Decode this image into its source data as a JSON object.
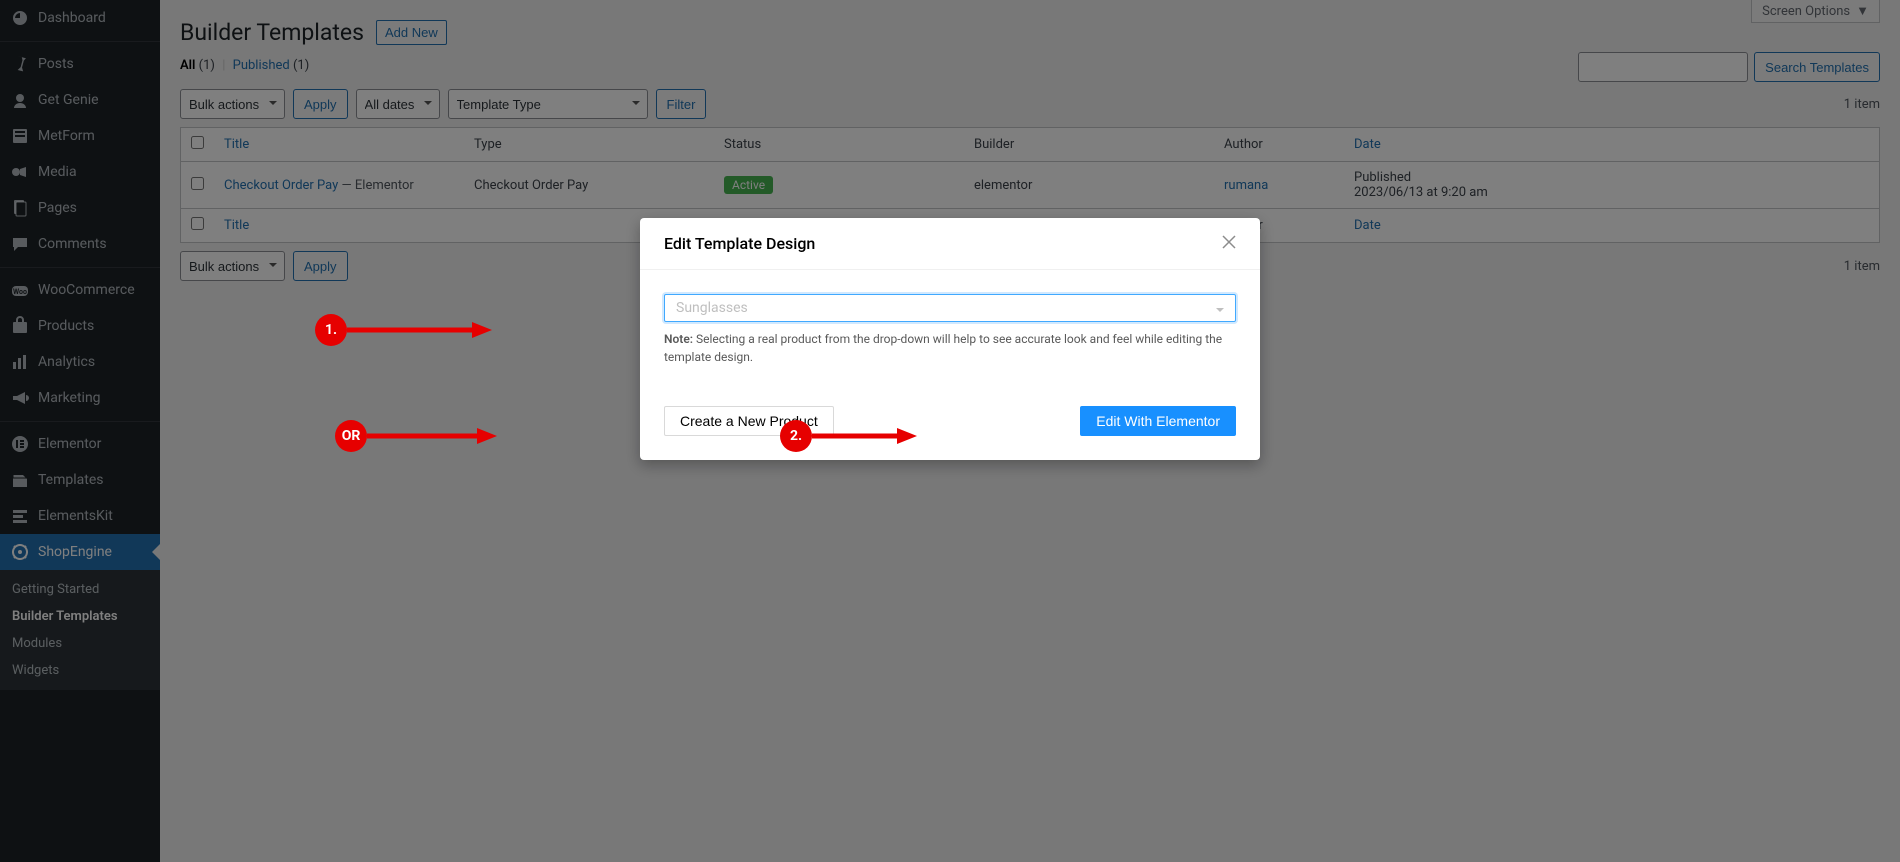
{
  "sidebar": {
    "items": [
      {
        "icon": "dashboard",
        "label": "Dashboard"
      },
      {
        "icon": "pin",
        "label": "Posts"
      },
      {
        "icon": "genie",
        "label": "Get Genie"
      },
      {
        "icon": "metform",
        "label": "MetForm"
      },
      {
        "icon": "media",
        "label": "Media"
      },
      {
        "icon": "pages",
        "label": "Pages"
      },
      {
        "icon": "comments",
        "label": "Comments"
      },
      {
        "icon": "woo",
        "label": "WooCommerce"
      },
      {
        "icon": "products",
        "label": "Products"
      },
      {
        "icon": "analytics",
        "label": "Analytics"
      },
      {
        "icon": "marketing",
        "label": "Marketing"
      },
      {
        "icon": "elementor",
        "label": "Elementor"
      },
      {
        "icon": "templates",
        "label": "Templates"
      },
      {
        "icon": "elementskit",
        "label": "ElementsKit"
      },
      {
        "icon": "shopengine",
        "label": "ShopEngine",
        "active": true
      }
    ],
    "submenu": [
      {
        "label": "Getting Started"
      },
      {
        "label": "Builder Templates",
        "current": true
      },
      {
        "label": "Modules"
      },
      {
        "label": "Widgets"
      }
    ]
  },
  "header": {
    "title": "Builder Templates",
    "add_new": "Add New",
    "screen_options": "Screen Options"
  },
  "subsubsub": {
    "all": "All",
    "all_count": "(1)",
    "published": "Published",
    "published_count": "(1)"
  },
  "filters": {
    "bulk": "Bulk actions",
    "apply": "Apply",
    "dates": "All dates",
    "template_type": "Template Type",
    "filter": "Filter",
    "search_btn": "Search Templates",
    "items": "1 item"
  },
  "table": {
    "cols": {
      "title": "Title",
      "type": "Type",
      "status": "Status",
      "builder": "Builder",
      "author": "Author",
      "date": "Date"
    },
    "rows": [
      {
        "title": "Checkout Order Pay",
        "suffix": "— Elementor",
        "type": "Checkout Order Pay",
        "status": "Active",
        "builder": "elementor",
        "author": "rumana",
        "date_a": "Published",
        "date_b": "2023/06/13 at 9:20 am"
      }
    ]
  },
  "modal": {
    "title": "Edit Template Design",
    "placeholder": "Sunglasses",
    "note_label": "Note:",
    "note_text": " Selecting a real product from the drop-down will help to see accurate look and feel while editing the template design.",
    "create_btn": "Create a New Product",
    "edit_btn": "Edit With Elementor"
  },
  "annotations": {
    "one": "1.",
    "two": "2.",
    "or": "OR"
  }
}
